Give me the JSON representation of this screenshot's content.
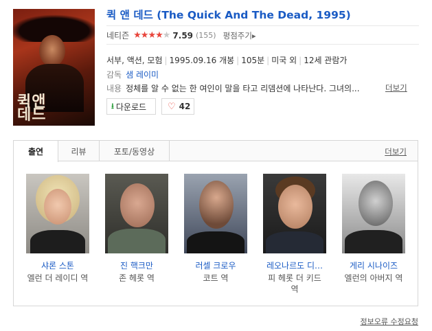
{
  "movie": {
    "title": "퀵 앤 데드 (The Quick And The Dead, 1995)",
    "poster_text": "퀵앤\n데드",
    "rating_label": "네티즌",
    "stars_filled": 4,
    "stars_total": 5,
    "score": "7.59",
    "rating_count": "(155)",
    "rate_link": "평점주기▸",
    "genre": "서부, 액션, 모험",
    "release": "1995.09.16 개봉",
    "runtime": "105분",
    "country": "미국 외",
    "age": "12세 관람가",
    "director_label": "감독",
    "director": "샘 레이미",
    "synopsis_label": "내용",
    "synopsis": "정체를 알 수 없는 한 여인이 말을 타고 리뎀션에 나타난다. 그녀의...",
    "more_label": "더보기"
  },
  "buttons": {
    "download": "다운로드",
    "like_count": "42"
  },
  "tabs": {
    "items": [
      {
        "label": "출연"
      },
      {
        "label": "리뷰"
      },
      {
        "label": "포토/동영상"
      }
    ],
    "more": "더보기"
  },
  "cast": [
    {
      "name": "샤론 스톤",
      "role": "엘런 더 레이디 역"
    },
    {
      "name": "진 핵크만",
      "role": "존 헤롯 역"
    },
    {
      "name": "러셀 크로우",
      "role": "코트 역"
    },
    {
      "name": "레오나르도 디…",
      "role": "피 헤롯 더 키드 역"
    },
    {
      "name": "게리 시나이즈",
      "role": "엘런의 아버지 역"
    }
  ],
  "footer": {
    "report_link": "정보오류 수정요청"
  },
  "colors": {
    "link_blue": "#1a5bc4",
    "star_red": "#e8453c"
  }
}
